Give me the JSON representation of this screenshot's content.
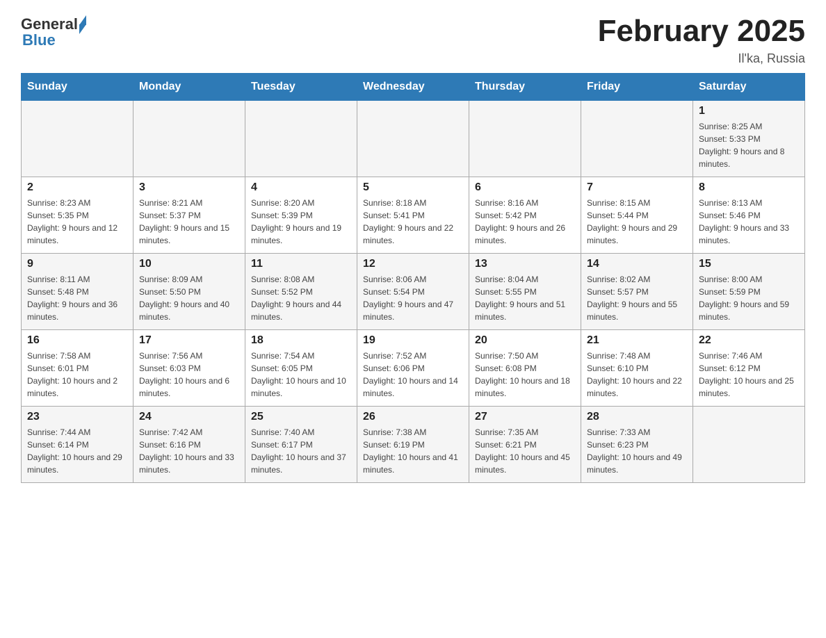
{
  "logo": {
    "text_general": "General",
    "text_blue": "Blue"
  },
  "header": {
    "month_title": "February 2025",
    "location": "Il'ka, Russia"
  },
  "weekdays": [
    "Sunday",
    "Monday",
    "Tuesday",
    "Wednesday",
    "Thursday",
    "Friday",
    "Saturday"
  ],
  "weeks": [
    [
      {
        "day": "",
        "sunrise": "",
        "sunset": "",
        "daylight": ""
      },
      {
        "day": "",
        "sunrise": "",
        "sunset": "",
        "daylight": ""
      },
      {
        "day": "",
        "sunrise": "",
        "sunset": "",
        "daylight": ""
      },
      {
        "day": "",
        "sunrise": "",
        "sunset": "",
        "daylight": ""
      },
      {
        "day": "",
        "sunrise": "",
        "sunset": "",
        "daylight": ""
      },
      {
        "day": "",
        "sunrise": "",
        "sunset": "",
        "daylight": ""
      },
      {
        "day": "1",
        "sunrise": "Sunrise: 8:25 AM",
        "sunset": "Sunset: 5:33 PM",
        "daylight": "Daylight: 9 hours and 8 minutes."
      }
    ],
    [
      {
        "day": "2",
        "sunrise": "Sunrise: 8:23 AM",
        "sunset": "Sunset: 5:35 PM",
        "daylight": "Daylight: 9 hours and 12 minutes."
      },
      {
        "day": "3",
        "sunrise": "Sunrise: 8:21 AM",
        "sunset": "Sunset: 5:37 PM",
        "daylight": "Daylight: 9 hours and 15 minutes."
      },
      {
        "day": "4",
        "sunrise": "Sunrise: 8:20 AM",
        "sunset": "Sunset: 5:39 PM",
        "daylight": "Daylight: 9 hours and 19 minutes."
      },
      {
        "day": "5",
        "sunrise": "Sunrise: 8:18 AM",
        "sunset": "Sunset: 5:41 PM",
        "daylight": "Daylight: 9 hours and 22 minutes."
      },
      {
        "day": "6",
        "sunrise": "Sunrise: 8:16 AM",
        "sunset": "Sunset: 5:42 PM",
        "daylight": "Daylight: 9 hours and 26 minutes."
      },
      {
        "day": "7",
        "sunrise": "Sunrise: 8:15 AM",
        "sunset": "Sunset: 5:44 PM",
        "daylight": "Daylight: 9 hours and 29 minutes."
      },
      {
        "day": "8",
        "sunrise": "Sunrise: 8:13 AM",
        "sunset": "Sunset: 5:46 PM",
        "daylight": "Daylight: 9 hours and 33 minutes."
      }
    ],
    [
      {
        "day": "9",
        "sunrise": "Sunrise: 8:11 AM",
        "sunset": "Sunset: 5:48 PM",
        "daylight": "Daylight: 9 hours and 36 minutes."
      },
      {
        "day": "10",
        "sunrise": "Sunrise: 8:09 AM",
        "sunset": "Sunset: 5:50 PM",
        "daylight": "Daylight: 9 hours and 40 minutes."
      },
      {
        "day": "11",
        "sunrise": "Sunrise: 8:08 AM",
        "sunset": "Sunset: 5:52 PM",
        "daylight": "Daylight: 9 hours and 44 minutes."
      },
      {
        "day": "12",
        "sunrise": "Sunrise: 8:06 AM",
        "sunset": "Sunset: 5:54 PM",
        "daylight": "Daylight: 9 hours and 47 minutes."
      },
      {
        "day": "13",
        "sunrise": "Sunrise: 8:04 AM",
        "sunset": "Sunset: 5:55 PM",
        "daylight": "Daylight: 9 hours and 51 minutes."
      },
      {
        "day": "14",
        "sunrise": "Sunrise: 8:02 AM",
        "sunset": "Sunset: 5:57 PM",
        "daylight": "Daylight: 9 hours and 55 minutes."
      },
      {
        "day": "15",
        "sunrise": "Sunrise: 8:00 AM",
        "sunset": "Sunset: 5:59 PM",
        "daylight": "Daylight: 9 hours and 59 minutes."
      }
    ],
    [
      {
        "day": "16",
        "sunrise": "Sunrise: 7:58 AM",
        "sunset": "Sunset: 6:01 PM",
        "daylight": "Daylight: 10 hours and 2 minutes."
      },
      {
        "day": "17",
        "sunrise": "Sunrise: 7:56 AM",
        "sunset": "Sunset: 6:03 PM",
        "daylight": "Daylight: 10 hours and 6 minutes."
      },
      {
        "day": "18",
        "sunrise": "Sunrise: 7:54 AM",
        "sunset": "Sunset: 6:05 PM",
        "daylight": "Daylight: 10 hours and 10 minutes."
      },
      {
        "day": "19",
        "sunrise": "Sunrise: 7:52 AM",
        "sunset": "Sunset: 6:06 PM",
        "daylight": "Daylight: 10 hours and 14 minutes."
      },
      {
        "day": "20",
        "sunrise": "Sunrise: 7:50 AM",
        "sunset": "Sunset: 6:08 PM",
        "daylight": "Daylight: 10 hours and 18 minutes."
      },
      {
        "day": "21",
        "sunrise": "Sunrise: 7:48 AM",
        "sunset": "Sunset: 6:10 PM",
        "daylight": "Daylight: 10 hours and 22 minutes."
      },
      {
        "day": "22",
        "sunrise": "Sunrise: 7:46 AM",
        "sunset": "Sunset: 6:12 PM",
        "daylight": "Daylight: 10 hours and 25 minutes."
      }
    ],
    [
      {
        "day": "23",
        "sunrise": "Sunrise: 7:44 AM",
        "sunset": "Sunset: 6:14 PM",
        "daylight": "Daylight: 10 hours and 29 minutes."
      },
      {
        "day": "24",
        "sunrise": "Sunrise: 7:42 AM",
        "sunset": "Sunset: 6:16 PM",
        "daylight": "Daylight: 10 hours and 33 minutes."
      },
      {
        "day": "25",
        "sunrise": "Sunrise: 7:40 AM",
        "sunset": "Sunset: 6:17 PM",
        "daylight": "Daylight: 10 hours and 37 minutes."
      },
      {
        "day": "26",
        "sunrise": "Sunrise: 7:38 AM",
        "sunset": "Sunset: 6:19 PM",
        "daylight": "Daylight: 10 hours and 41 minutes."
      },
      {
        "day": "27",
        "sunrise": "Sunrise: 7:35 AM",
        "sunset": "Sunset: 6:21 PM",
        "daylight": "Daylight: 10 hours and 45 minutes."
      },
      {
        "day": "28",
        "sunrise": "Sunrise: 7:33 AM",
        "sunset": "Sunset: 6:23 PM",
        "daylight": "Daylight: 10 hours and 49 minutes."
      },
      {
        "day": "",
        "sunrise": "",
        "sunset": "",
        "daylight": ""
      }
    ]
  ]
}
